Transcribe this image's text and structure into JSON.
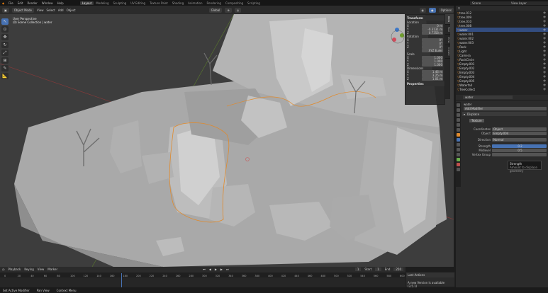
{
  "topbar": {
    "menu": [
      "File",
      "Edit",
      "Render",
      "Window",
      "Help"
    ],
    "tabs": [
      "Layout",
      "Modeling",
      "Sculpting",
      "UV Editing",
      "Texture Paint",
      "Shading",
      "Animation",
      "Rendering",
      "Compositing",
      "Scripting"
    ],
    "scene": "Scene",
    "view_layer": "View Layer"
  },
  "viewport_header": {
    "mode": "Object Mode",
    "menus": [
      "View",
      "Select",
      "Add",
      "Object"
    ],
    "transform": "Global",
    "options": "Options"
  },
  "viewport_info": {
    "line1": "User Perspective",
    "line2": "(0) Scene Collection | water"
  },
  "npanel": {
    "transform": "Transform",
    "location": "Location",
    "rotation": "Rotation",
    "scale": "Scale",
    "dimensions": "Dimensions",
    "properties": "Properties",
    "mode": "XYZ Euler",
    "loc": [
      {
        "a": "X",
        "v": "0 m"
      },
      {
        "a": "Y",
        "v": "-0.3131 m"
      },
      {
        "a": "Z",
        "v": "0.7358 m"
      }
    ],
    "rot": [
      {
        "a": "X",
        "v": "0°"
      },
      {
        "a": "Y",
        "v": "0°"
      },
      {
        "a": "Z",
        "v": "0°"
      }
    ],
    "scl": [
      {
        "a": "X",
        "v": "1.000"
      },
      {
        "a": "Y",
        "v": "1.000"
      },
      {
        "a": "Z",
        "v": "1.000"
      }
    ],
    "dim": [
      {
        "a": "X",
        "v": "1.46 m"
      },
      {
        "a": "Y",
        "v": "3.25 m"
      },
      {
        "a": "Z",
        "v": "1.01 m"
      }
    ],
    "tabs": [
      "Item",
      "Tool",
      "View",
      "Create"
    ]
  },
  "timeline": {
    "menus": [
      "Playback",
      "Keying",
      "View",
      "Marker"
    ],
    "start": "Start",
    "start_val": "1",
    "end": "End",
    "end_val": "250",
    "current": "1",
    "ticks": [
      "0",
      "20",
      "40",
      "60",
      "80",
      "100",
      "120",
      "140",
      "160",
      "180",
      "200",
      "220",
      "240",
      "260",
      "280",
      "300",
      "320",
      "340",
      "360",
      "380",
      "400",
      "420",
      "440",
      "460",
      "480",
      "500",
      "520",
      "540",
      "560",
      "580",
      "600"
    ]
  },
  "statusbar": {
    "items": [
      "Set Active Modifier",
      "Pan View",
      "Context Menu"
    ]
  },
  "last_op": {
    "title": "Last Actions",
    "text": "A new Version is available (3.5.1)"
  },
  "outliner": {
    "rows": [
      "tree.012",
      "tree.009",
      "tree.010",
      "tree.008",
      "water",
      "water.001",
      "water.002",
      "water.003",
      "Rock",
      "Light",
      "Camera",
      "RockCircle",
      "Empty.001",
      "Empty.002",
      "Empty.003",
      "Empty.004",
      "Empty.005",
      "Waterfall",
      "TreeCollect"
    ]
  },
  "properties": {
    "object": "water",
    "name": "water",
    "modifier_add": "Add Modifier",
    "modifier": "Displace",
    "texture": "Texture",
    "coords_label": "Coordinates",
    "coords": "Object",
    "object_label": "Object",
    "object_val": "Empty.004",
    "direction_label": "Direction",
    "direction": "Normal",
    "strength_label": "Strength",
    "strength": "0.2",
    "midlevel_label": "Midlevel",
    "midlevel": "0.5",
    "vgroup_label": "Vertex Group",
    "tooltip": "Strength",
    "tooltip2": "Amount to displace geometry"
  }
}
